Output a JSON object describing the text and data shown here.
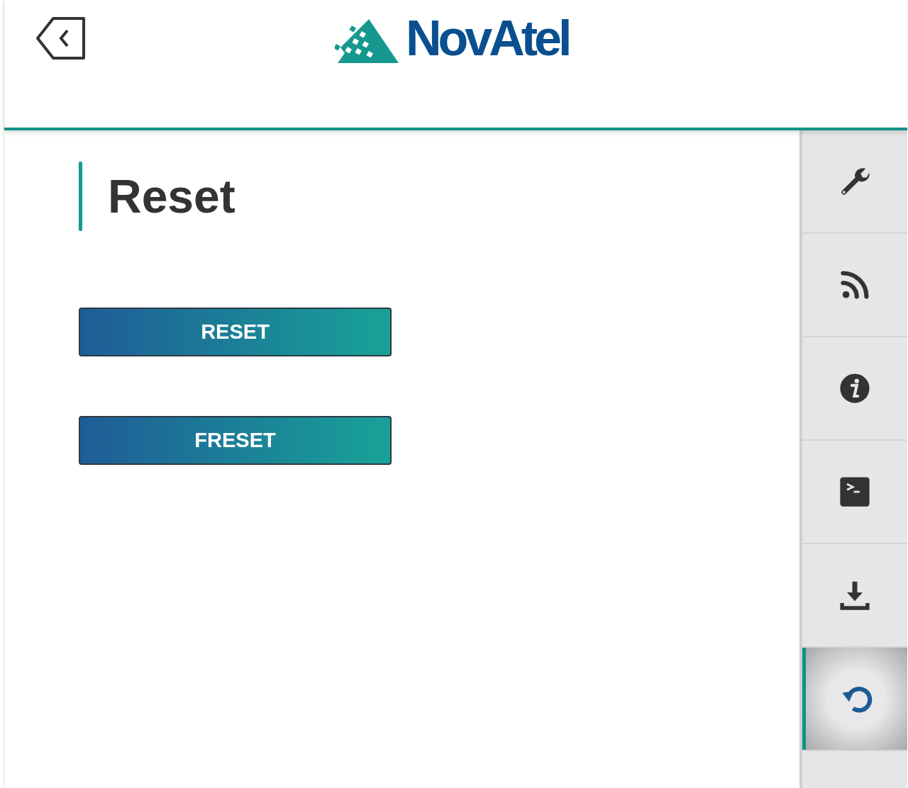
{
  "header": {
    "logo": "NovAtel"
  },
  "page": {
    "title": "Reset"
  },
  "buttons": [
    {
      "label": "RESET"
    },
    {
      "label": "FRESET"
    }
  ],
  "sidebar": {
    "items": [
      {
        "kind": "wrench",
        "selected": false
      },
      {
        "kind": "feed",
        "selected": false
      },
      {
        "kind": "info",
        "selected": false
      },
      {
        "kind": "terminal",
        "selected": false
      },
      {
        "kind": "download",
        "selected": false
      },
      {
        "kind": "reset",
        "selected": true
      },
      {
        "kind": "empty",
        "selected": false
      }
    ]
  }
}
